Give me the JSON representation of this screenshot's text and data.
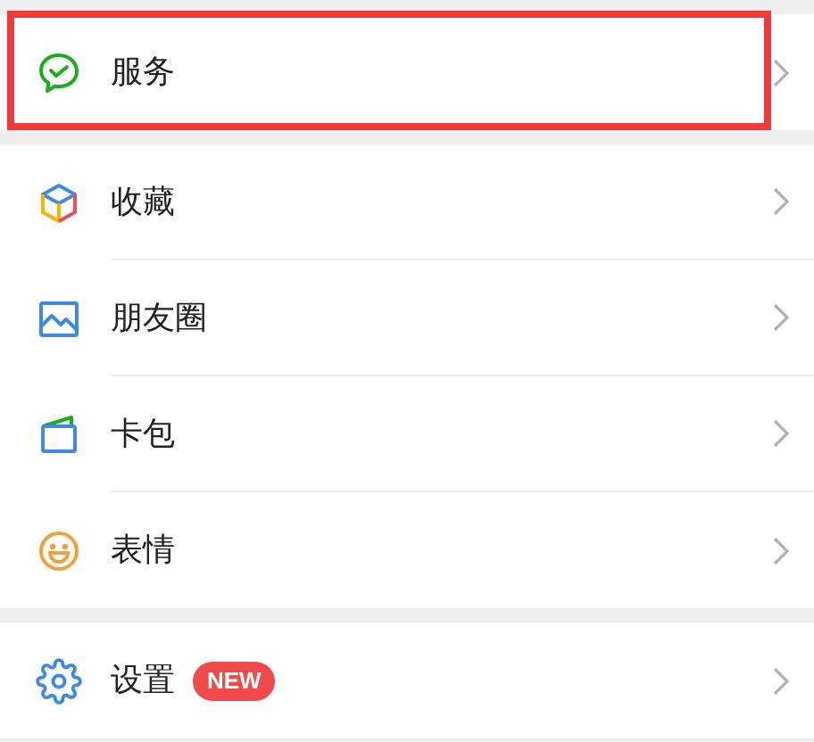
{
  "groups": [
    {
      "items": [
        {
          "kind": "service",
          "label": "服务",
          "highlighted": true
        }
      ]
    },
    {
      "items": [
        {
          "kind": "favorites",
          "label": "收藏",
          "highlighted": false
        },
        {
          "kind": "moments",
          "label": "朋友圈",
          "highlighted": false
        },
        {
          "kind": "cards",
          "label": "卡包",
          "highlighted": false
        },
        {
          "kind": "stickers",
          "label": "表情",
          "highlighted": false
        }
      ]
    },
    {
      "items": [
        {
          "kind": "settings",
          "label": "设置",
          "badge": "NEW",
          "highlighted": false
        }
      ]
    }
  ]
}
